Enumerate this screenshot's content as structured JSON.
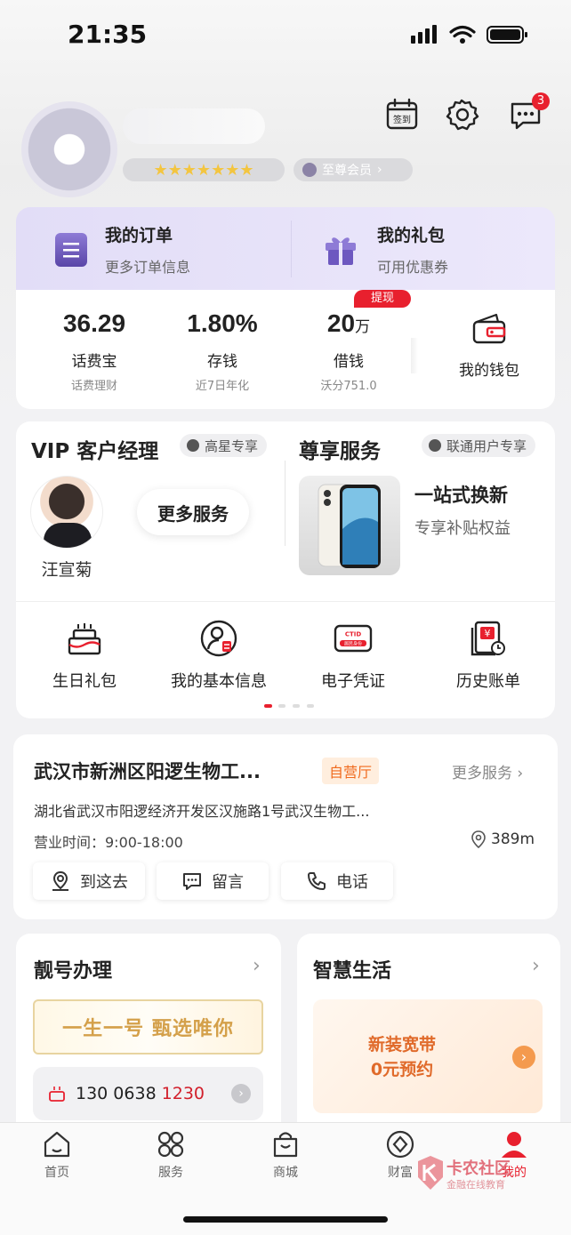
{
  "status_bar": {
    "time": "21:35"
  },
  "header": {
    "checkin_label": "签到",
    "notification_count": "3",
    "member_level": "至尊会员",
    "stars": "★★★★★★★"
  },
  "top_card": {
    "orders": {
      "title": "我的订单",
      "subtitle": "更多订单信息"
    },
    "gifts": {
      "title": "我的礼包",
      "subtitle": "可用优惠券"
    },
    "withdraw_tag": "提现",
    "stats": [
      {
        "value": "36.29",
        "unit": "",
        "label": "话费宝",
        "sub": "话费理财"
      },
      {
        "value": "1.80%",
        "unit": "",
        "label": "存钱",
        "sub": "近7日年化"
      },
      {
        "value": "20",
        "unit": "万",
        "label": "借钱",
        "sub": "沃分751.0"
      }
    ],
    "wallet_label": "我的钱包"
  },
  "vip": {
    "title": "VIP 客户经理",
    "badge": "高星专享",
    "manager_name": "汪宣菊",
    "more_services": "更多服务",
    "exclusive_title": "尊享服务",
    "exclusive_badge": "联通用户专享",
    "trade_in_title": "一站式换新",
    "trade_in_sub": "专享补贴权益",
    "grid": [
      {
        "label": "生日礼包",
        "icon": "cake-icon"
      },
      {
        "label": "我的基本信息",
        "icon": "profile-icon"
      },
      {
        "label": "电子凭证",
        "icon": "id-card-icon"
      },
      {
        "label": "历史账单",
        "icon": "bill-icon"
      }
    ],
    "id_card_text": "CTID",
    "id_card_sub": "居民身份"
  },
  "store": {
    "name": "武汉市新洲区阳逻生物工...",
    "tag": "自营厅",
    "more": "更多服务",
    "address": "湖北省武汉市阳逻经济开发区汉施路1号武汉生物工...",
    "hours": "营业时间：9:00-18:00",
    "distance": "389m",
    "actions": [
      "到这去",
      "留言",
      "电话"
    ]
  },
  "number_card": {
    "title": "靓号办理",
    "banner": "一生一号 甄选唯你",
    "number_prefix": "130 0638",
    "number_highlight": "1230"
  },
  "life_card": {
    "title": "智慧生活",
    "promo_line1": "新装宽带",
    "promo_line2": "0元预约"
  },
  "tabbar": {
    "tabs": [
      {
        "label": "首页",
        "icon": "home-icon"
      },
      {
        "label": "服务",
        "icon": "services-icon"
      },
      {
        "label": "商城",
        "icon": "shop-bag-icon"
      },
      {
        "label": "财富",
        "icon": "wealth-icon"
      },
      {
        "label": "我的",
        "icon": "profile-tab-icon"
      }
    ]
  },
  "watermark": {
    "title": "卡农社区",
    "sub": "金融在线教育"
  },
  "colors": {
    "accent_red": "#e8202e",
    "purple": "#e2ddf7",
    "orange": "#f06a1d",
    "gold": "#d4a04a"
  }
}
